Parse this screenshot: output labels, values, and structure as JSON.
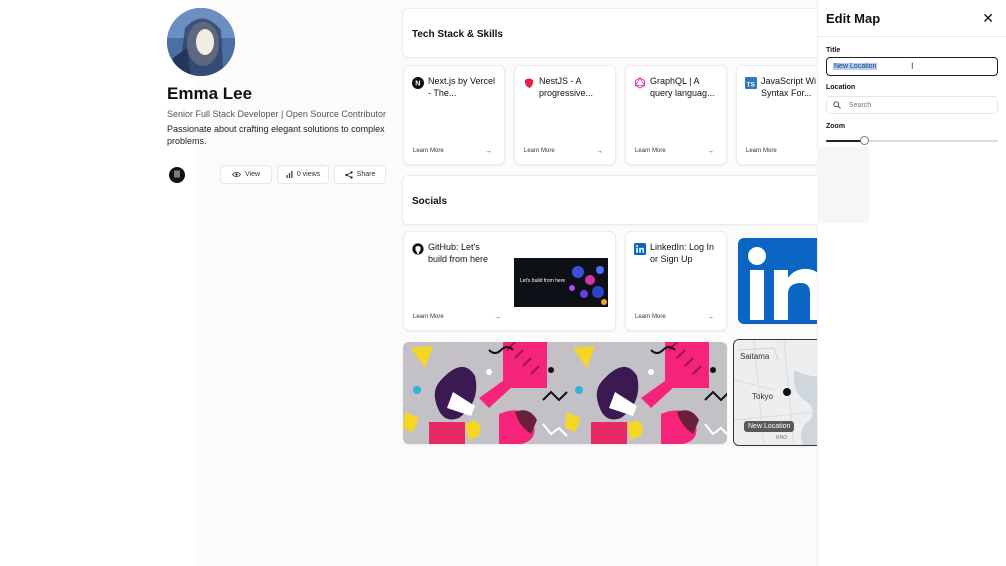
{
  "profile": {
    "name": "Emma Lee",
    "role": "Senior Full Stack Developer | Open Source Contributor",
    "bio": "Passionate about crafting elegant solutions to complex problems.",
    "view_label": "View",
    "views_label": "0 views",
    "share_label": "Share"
  },
  "tech": {
    "heading": "Tech Stack & Skills",
    "cards": [
      {
        "title": "Next.js by Vercel - The...",
        "cta": "Learn More"
      },
      {
        "title": "NestJS - A progressive...",
        "cta": "Learn More"
      },
      {
        "title": "GraphQL | A query languag...",
        "cta": "Learn More"
      },
      {
        "title": "JavaScript Wi Syntax For...",
        "cta": "Learn More"
      }
    ]
  },
  "socials": {
    "heading": "Socials",
    "github": {
      "title": "GitHub: Let's build from here",
      "thumb_text": "Let's build from here",
      "cta": "Learn More"
    },
    "linkedin": {
      "title": "LinkedIn: Log In or Sign Up",
      "cta": "Learn More"
    }
  },
  "map": {
    "labels": [
      "Saitama",
      "Tokyo"
    ],
    "pill": "New Location",
    "footer": "RNO"
  },
  "edit_map": {
    "title": "Edit Map",
    "title_label": "Title",
    "title_value": "New Location",
    "location_label": "Location",
    "location_placeholder": "Search",
    "zoom_label": "Zoom",
    "zoom_value": 0.22
  },
  "colors": {
    "accent": "#111111",
    "linkedin_blue": "#0a66c2",
    "selection": "#b4cff5"
  }
}
